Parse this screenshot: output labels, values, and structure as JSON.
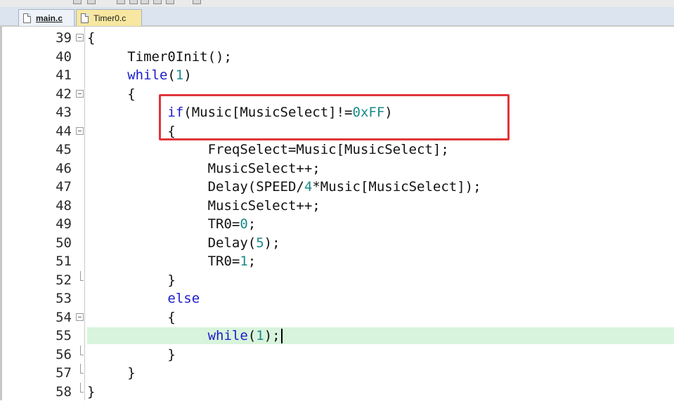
{
  "tabs": [
    {
      "label": "main.c",
      "active": true
    },
    {
      "label": "Timer0.c",
      "active": false
    }
  ],
  "colors": {
    "keyword": "#1c1cc8",
    "number": "#1a8a8a",
    "current_line": "#d8f4dc",
    "annotation_box": "#e0363b"
  },
  "editor": {
    "current_line": "55",
    "lines": [
      {
        "num": "39",
        "fold": "open",
        "tokens": [
          {
            "t": "{",
            "c": ""
          }
        ]
      },
      {
        "num": "40",
        "fold": "",
        "tokens": [
          {
            "t": "     Timer0Init();",
            "c": ""
          }
        ]
      },
      {
        "num": "41",
        "fold": "",
        "tokens": [
          {
            "t": "     ",
            "c": ""
          },
          {
            "t": "while",
            "c": "kw"
          },
          {
            "t": "(",
            "c": ""
          },
          {
            "t": "1",
            "c": "num"
          },
          {
            "t": ")",
            "c": ""
          }
        ]
      },
      {
        "num": "42",
        "fold": "open",
        "tokens": [
          {
            "t": "     {",
            "c": ""
          }
        ]
      },
      {
        "num": "43",
        "fold": "",
        "tokens": [
          {
            "t": "          ",
            "c": ""
          },
          {
            "t": "if",
            "c": "kw"
          },
          {
            "t": "(Music[MusicSelect]!=",
            "c": ""
          },
          {
            "t": "0xFF",
            "c": "num"
          },
          {
            "t": ")",
            "c": ""
          }
        ]
      },
      {
        "num": "44",
        "fold": "open",
        "tokens": [
          {
            "t": "          {",
            "c": ""
          }
        ]
      },
      {
        "num": "45",
        "fold": "",
        "tokens": [
          {
            "t": "               FreqSelect=Music[MusicSelect];",
            "c": ""
          }
        ]
      },
      {
        "num": "46",
        "fold": "",
        "tokens": [
          {
            "t": "               MusicSelect++;",
            "c": ""
          }
        ]
      },
      {
        "num": "47",
        "fold": "",
        "tokens": [
          {
            "t": "               Delay(SPEED/",
            "c": ""
          },
          {
            "t": "4",
            "c": "num"
          },
          {
            "t": "*Music[MusicSelect]);",
            "c": ""
          }
        ]
      },
      {
        "num": "48",
        "fold": "",
        "tokens": [
          {
            "t": "               MusicSelect++;",
            "c": ""
          }
        ]
      },
      {
        "num": "49",
        "fold": "",
        "tokens": [
          {
            "t": "               TR0=",
            "c": ""
          },
          {
            "t": "0",
            "c": "num"
          },
          {
            "t": ";",
            "c": ""
          }
        ]
      },
      {
        "num": "50",
        "fold": "",
        "tokens": [
          {
            "t": "               Delay(",
            "c": ""
          },
          {
            "t": "5",
            "c": "num"
          },
          {
            "t": ");",
            "c": ""
          }
        ]
      },
      {
        "num": "51",
        "fold": "",
        "tokens": [
          {
            "t": "               TR0=",
            "c": ""
          },
          {
            "t": "1",
            "c": "num"
          },
          {
            "t": ";",
            "c": ""
          }
        ]
      },
      {
        "num": "52",
        "fold": "end",
        "tokens": [
          {
            "t": "          }",
            "c": ""
          }
        ]
      },
      {
        "num": "53",
        "fold": "",
        "tokens": [
          {
            "t": "          ",
            "c": ""
          },
          {
            "t": "else",
            "c": "kw"
          }
        ]
      },
      {
        "num": "54",
        "fold": "open",
        "tokens": [
          {
            "t": "          {",
            "c": ""
          }
        ]
      },
      {
        "num": "55",
        "fold": "",
        "tokens": [
          {
            "t": "               ",
            "c": ""
          },
          {
            "t": "while",
            "c": "kw"
          },
          {
            "t": "(",
            "c": ""
          },
          {
            "t": "1",
            "c": "num"
          },
          {
            "t": ");",
            "c": ""
          }
        ]
      },
      {
        "num": "56",
        "fold": "end",
        "tokens": [
          {
            "t": "          }",
            "c": ""
          }
        ]
      },
      {
        "num": "57",
        "fold": "end",
        "tokens": [
          {
            "t": "     }",
            "c": ""
          }
        ]
      },
      {
        "num": "58",
        "fold": "end",
        "tokens": [
          {
            "t": "}",
            "c": ""
          }
        ]
      }
    ]
  }
}
